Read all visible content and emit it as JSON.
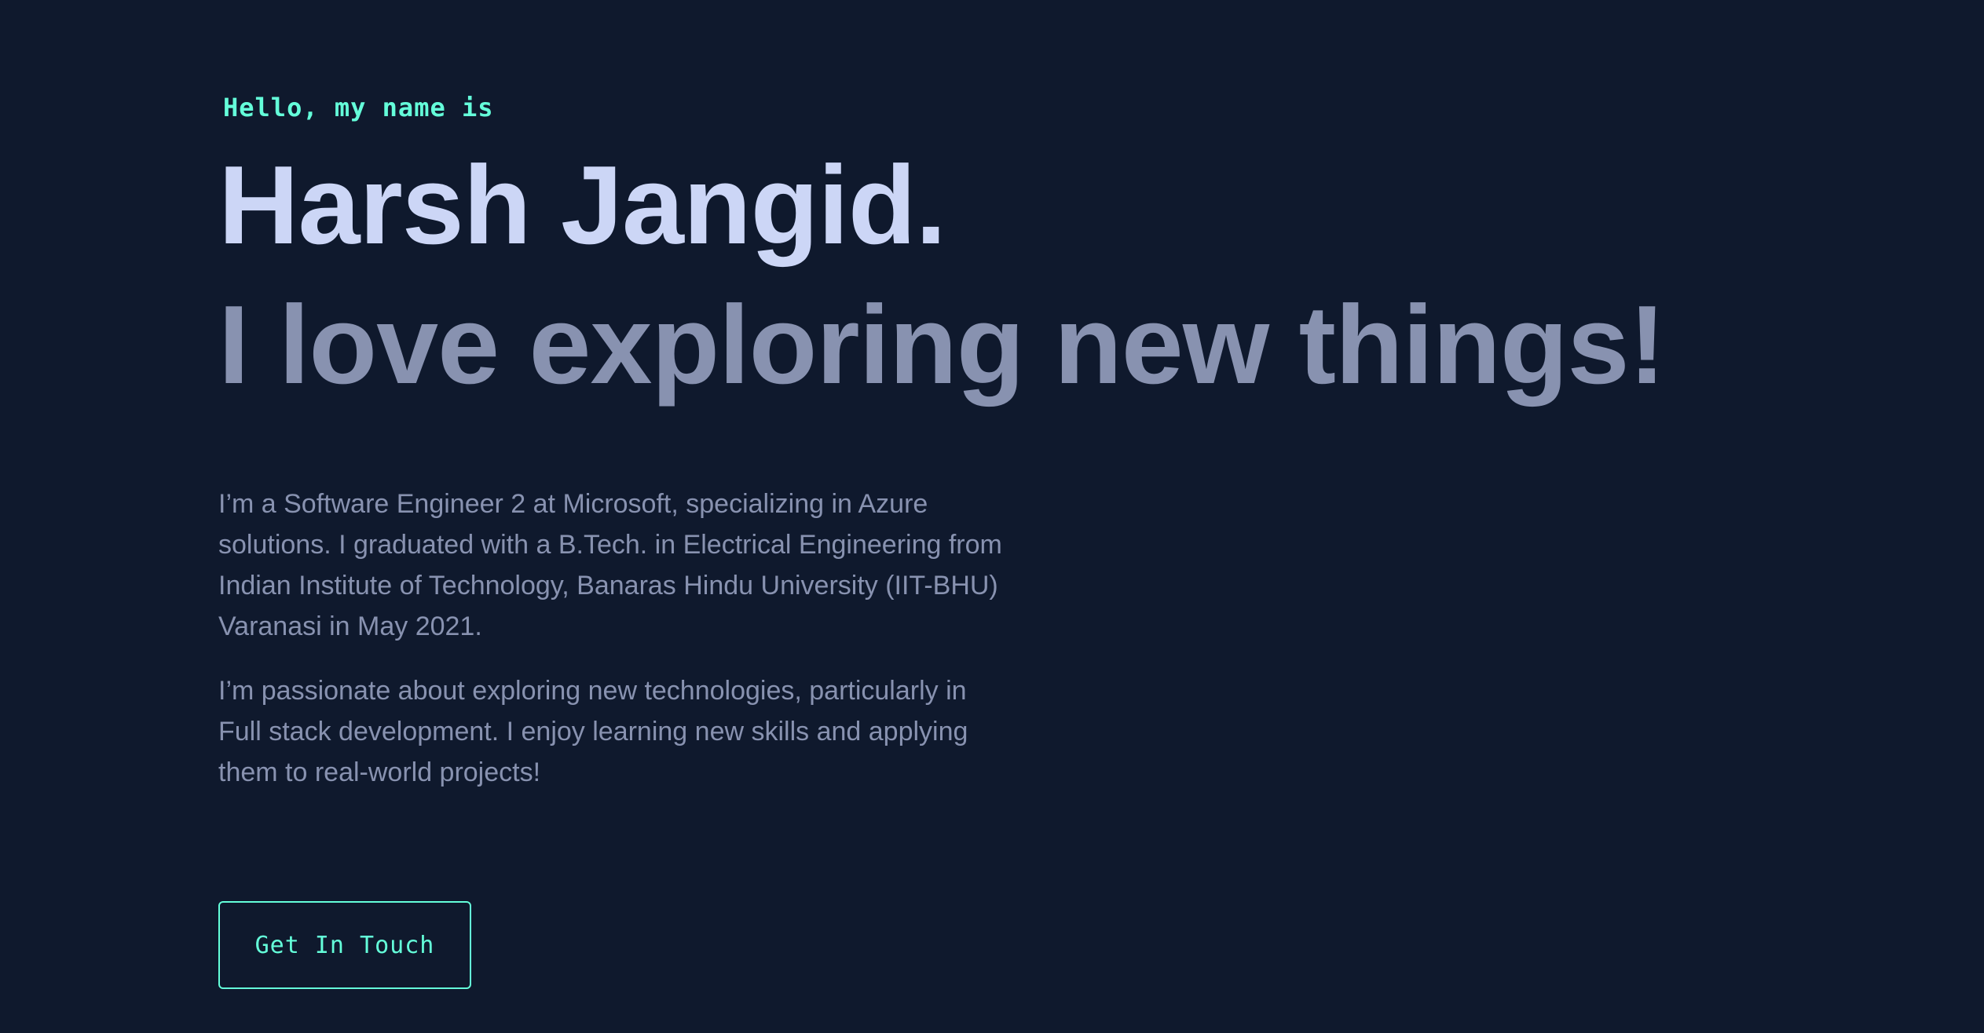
{
  "theme": {
    "background": "#0f192d",
    "accent": "#64ffda",
    "heading": "#ccd6f6",
    "muted": "#8892b0"
  },
  "hero": {
    "greeting": "Hello, my name is",
    "name": "Harsh Jangid.",
    "tagline": "I love exploring new things!",
    "about": [
      "I’m a Software Engineer 2 at Microsoft, specializing in Azure solutions. I graduated with a B.Tech. in Electrical Engineering from Indian Institute of Technology, Banaras Hindu University (IIT-BHU) Varanasi in May 2021.",
      "I’m passionate about exploring new technologies, particularly in Full stack development. I enjoy learning new skills and applying them to real-world projects!"
    ],
    "cta_label": "Get In Touch"
  }
}
